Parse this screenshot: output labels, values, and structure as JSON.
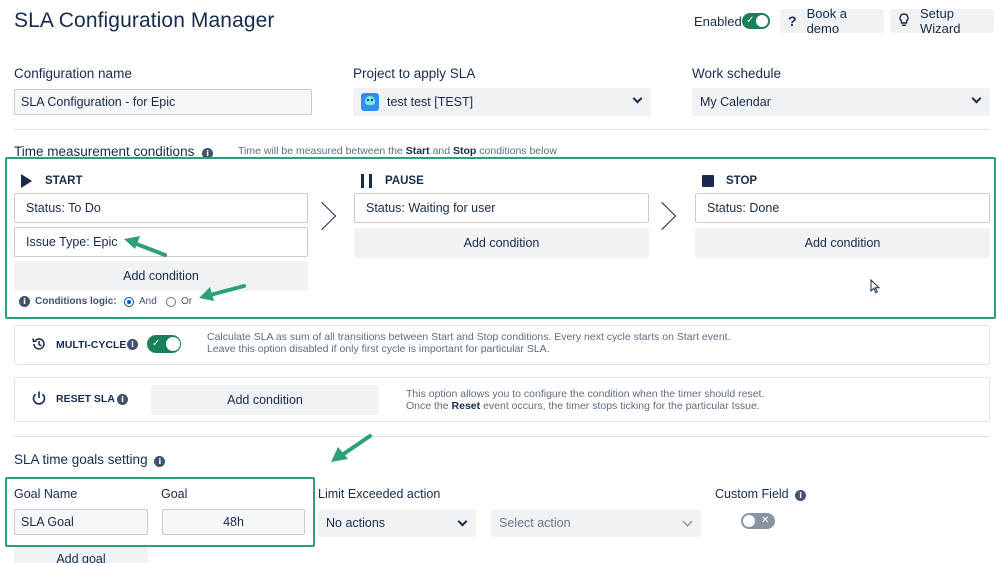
{
  "header": {
    "title": "SLA Configuration Manager",
    "enabled_label": "Enabled",
    "book_demo": "Book a demo",
    "setup_wizard": "Setup Wizard"
  },
  "config": {
    "name_label": "Configuration name",
    "name_value": "SLA Configuration - for Epic",
    "project_label": "Project to apply SLA",
    "project_value": "test test [TEST]",
    "schedule_label": "Work schedule",
    "schedule_value": "My Calendar"
  },
  "time_conditions": {
    "title": "Time measurement conditions",
    "hint_pre": "Time will be measured between the",
    "hint_start": "Start",
    "hint_and": "and",
    "hint_stop": "Stop",
    "hint_post": "conditions below",
    "start": {
      "header": "START",
      "conditions": [
        "Status: To Do",
        "Issue Type: Epic"
      ],
      "add_label": "Add condition",
      "logic_label": "Conditions logic:",
      "logic_and": "And",
      "logic_or": "Or",
      "logic_selected": "And"
    },
    "pause": {
      "header": "PAUSE",
      "conditions": [
        "Status: Waiting for user"
      ],
      "add_label": "Add condition"
    },
    "stop": {
      "header": "STOP",
      "conditions": [
        "Status: Done"
      ],
      "add_label": "Add condition"
    }
  },
  "multi_cycle": {
    "title": "MULTI-CYCLE",
    "enabled": true,
    "desc_line1": "Calculate SLA as sum of all transitions between Start and Stop conditions. Every next cycle starts on Start event.",
    "desc_line2": "Leave this option disabled if only first cycle is important for particular SLA."
  },
  "reset_sla": {
    "title": "RESET SLA",
    "add_label": "Add condition",
    "desc_line1": "This option allows you to configure the condition when the timer should reset.",
    "desc_line2_pre": "Once the",
    "desc_line2_bold": "Reset",
    "desc_line2_post": "event occurs, the timer stops ticking for the particular Issue."
  },
  "goals": {
    "title": "SLA time goals setting",
    "goal_name_label": "Goal Name",
    "goal_label": "Goal",
    "limit_label": "Limit Exceeded action",
    "custom_field_label": "Custom Field",
    "goal_name_value": "SLA Goal",
    "goal_value": "48h",
    "limit_value": "No actions",
    "select_action_placeholder": "Select action",
    "custom_field_enabled": false,
    "add_goal_label": "Add goal"
  },
  "colors": {
    "accent_green": "#2da07a",
    "toggle_green": "#1b7f5a",
    "text": "#172b4d"
  }
}
